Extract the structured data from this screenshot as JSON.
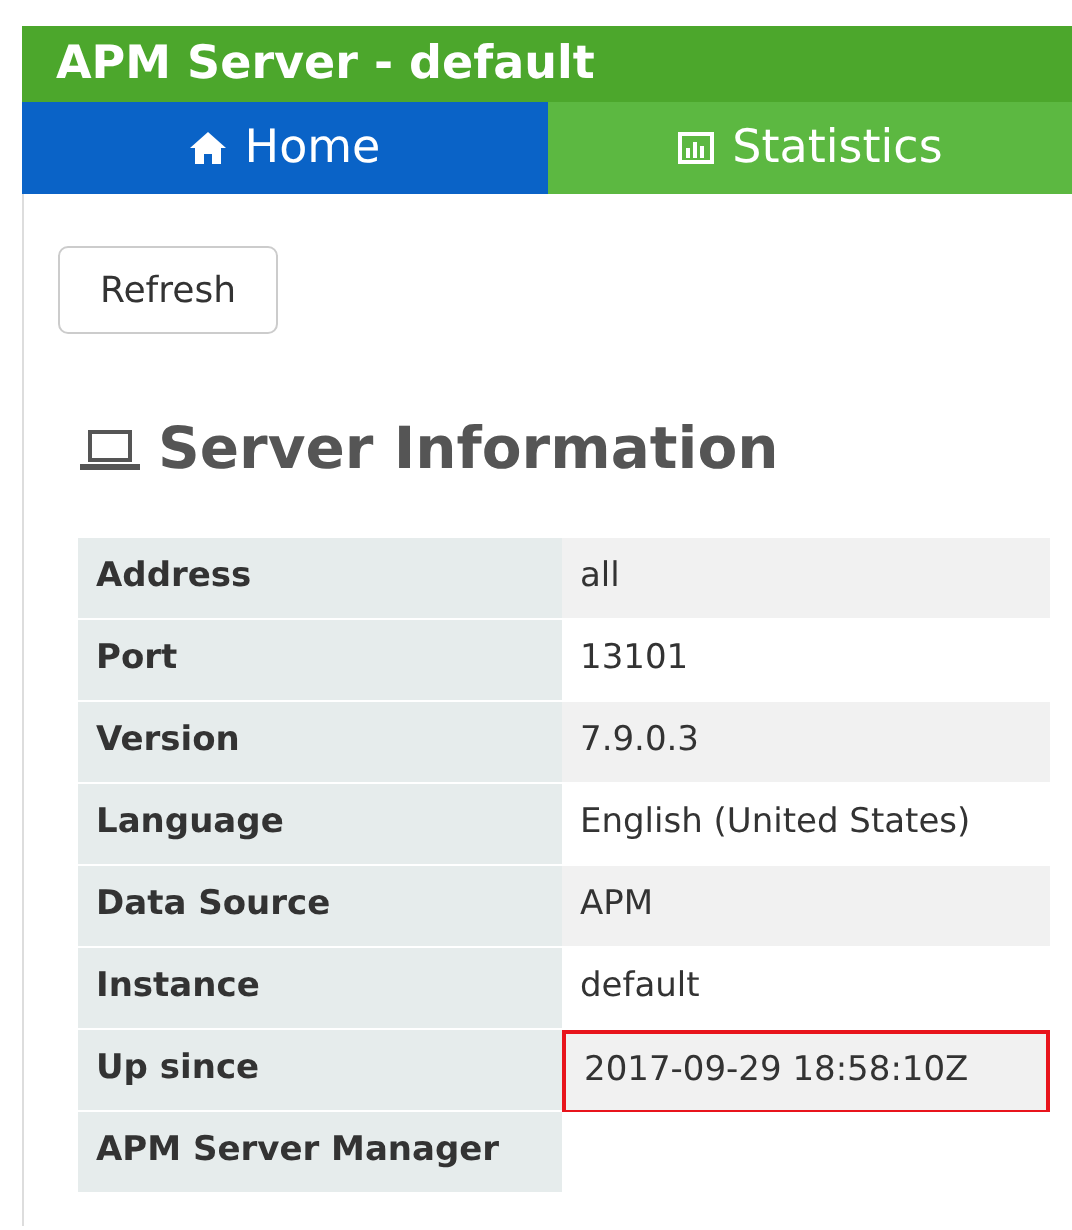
{
  "window": {
    "title": "APM Server - default"
  },
  "tabs": [
    {
      "label": "Home",
      "kind": "home",
      "selected": true
    },
    {
      "label": "Statistics",
      "kind": "statistics",
      "selected": false
    }
  ],
  "refresh_button": "Refresh",
  "section": {
    "title": "Server Information"
  },
  "rows": [
    {
      "label": "Address",
      "value": "all",
      "highlighted": false
    },
    {
      "label": "Port",
      "value": "13101",
      "highlighted": false
    },
    {
      "label": "Version",
      "value": "7.9.0.3",
      "highlighted": false
    },
    {
      "label": "Language",
      "value": "English (United States)",
      "highlighted": false
    },
    {
      "label": "Data Source",
      "value": "APM",
      "highlighted": false
    },
    {
      "label": "Instance",
      "value": "default",
      "highlighted": false
    },
    {
      "label": "Up since",
      "value": "2017-09-29 18:58:10Z",
      "highlighted": true
    },
    {
      "label": "APM Server Manager",
      "value": "",
      "highlighted": false
    }
  ]
}
